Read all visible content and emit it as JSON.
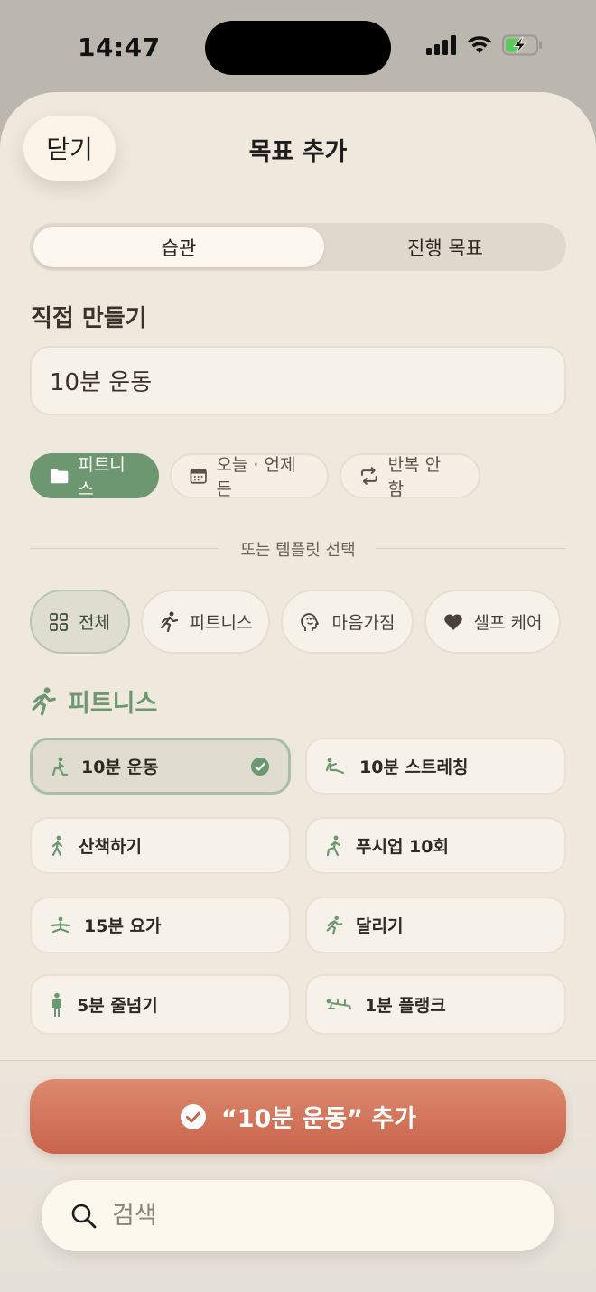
{
  "status_bar": {
    "time": "14:47"
  },
  "sheet": {
    "close_label": "닫기",
    "title": "목표 추가"
  },
  "segment": {
    "options": [
      {
        "label": "습관",
        "selected": true
      },
      {
        "label": "진행 목표",
        "selected": false
      }
    ]
  },
  "custom": {
    "section_label": "직접 만들기",
    "name_value": "10분 운동"
  },
  "chips": {
    "category": "피트니스",
    "date": "오늘 · 언제든",
    "repeat": "반복 안 함"
  },
  "divider": {
    "text": "또는 템플릿 선택"
  },
  "filters": [
    {
      "label": "전체",
      "icon": "grid-icon",
      "selected": true
    },
    {
      "label": "피트니스",
      "icon": "running-icon",
      "selected": false
    },
    {
      "label": "마음가짐",
      "icon": "brain-icon",
      "selected": false
    },
    {
      "label": "셀프 케어",
      "icon": "heart-icon",
      "selected": false
    }
  ],
  "group": {
    "title": "피트니스",
    "icon": "running-icon",
    "color": "#6d9770"
  },
  "templates": [
    {
      "label": "10분 운동",
      "icon": "lunge-icon",
      "selected": true
    },
    {
      "label": "10분 스트레칭",
      "icon": "stretch-icon",
      "selected": false
    },
    {
      "label": "산책하기",
      "icon": "walking-icon",
      "selected": false
    },
    {
      "label": "푸시업 10회",
      "icon": "pushup-icon",
      "selected": false
    },
    {
      "label": "15분 요가",
      "icon": "yoga-icon",
      "selected": false
    },
    {
      "label": "달리기",
      "icon": "running-icon",
      "selected": false
    },
    {
      "label": "5분 줄넘기",
      "icon": "standing-icon",
      "selected": false
    },
    {
      "label": "1분 플랭크",
      "icon": "plank-icon",
      "selected": false
    }
  ],
  "add_button": {
    "label": "“10분 운동” 추가",
    "color": "#c8644b"
  },
  "search": {
    "placeholder": "검색"
  }
}
